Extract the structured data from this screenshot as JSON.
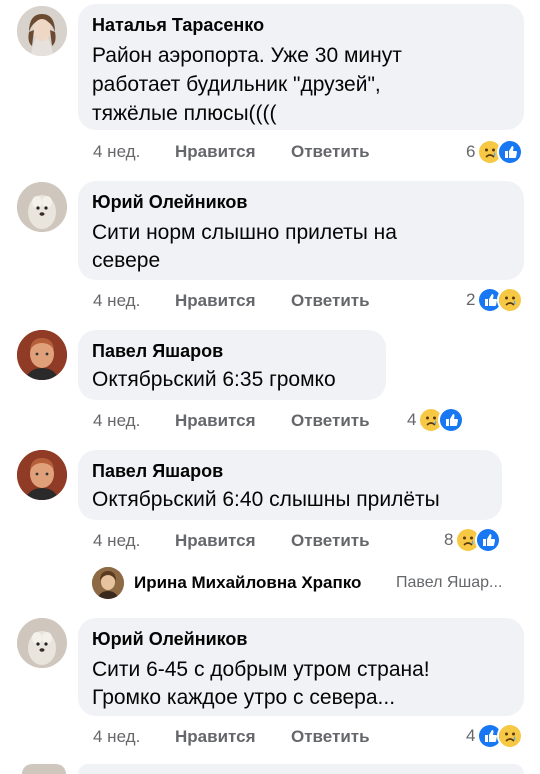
{
  "comments": [
    {
      "author": "Наталья Тарасенко",
      "text": "Район аэропорта. Уже 30 минут\nработает будильник \"друзей\",\nтяжёлые плюсы((((",
      "time": "4 нед.",
      "like": "Нравится",
      "reply": "Ответить",
      "count": "6",
      "reactions": [
        "sad-icon",
        "like-icon"
      ]
    },
    {
      "author": "Юрий Олейников",
      "text": "Сити норм слышно прилеты на\nсевере",
      "time": "4 нед.",
      "like": "Нравится",
      "reply": "Ответить",
      "count": "2",
      "reactions": [
        "like-icon",
        "sad-icon"
      ]
    },
    {
      "author": "Павел Яшаров",
      "text": "Октябрьский 6:35 громко",
      "time": "4 нед.",
      "like": "Нравится",
      "reply": "Ответить",
      "count": "4",
      "reactions": [
        "sad-icon",
        "like-icon"
      ]
    },
    {
      "author": "Павел Яшаров",
      "text": "Октябрьский 6:40 слышны прилёты",
      "time": "4 нед.",
      "like": "Нравится",
      "reply": "Ответить",
      "count": "8",
      "reactions": [
        "sad-icon",
        "like-icon"
      ]
    },
    {
      "author": "Юрий Олейников",
      "text": "Сити 6-45 с добрым утром страна!\nГромко каждое утро с севера...",
      "time": "4 нед.",
      "like": "Нравится",
      "reply": "Ответить",
      "count": "4",
      "reactions": [
        "like-icon",
        "sad-icon"
      ]
    }
  ],
  "reply_preview": {
    "author": "Ирина Михайловна Храпко",
    "preview": "Павел Яшар..."
  },
  "colors": {
    "like": "#1877f2",
    "sad": "#f7c843",
    "bubble": "#f0f2f5",
    "meta": "#65676b"
  }
}
